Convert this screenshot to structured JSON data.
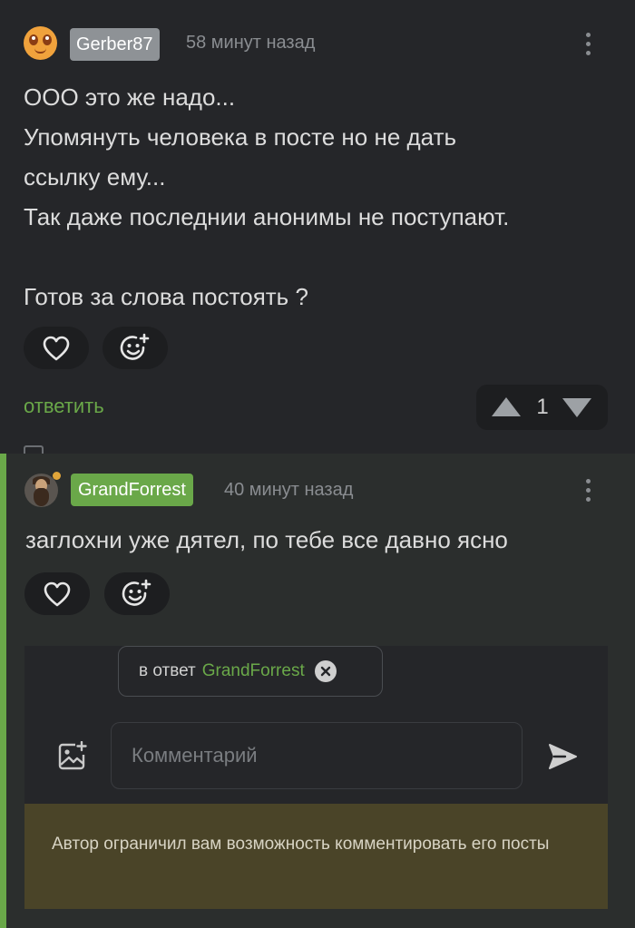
{
  "comments": [
    {
      "author": "Gerber87",
      "time": "58 минут назад",
      "body_lines": [
        "ООО это же надо...",
        "Упомянуть человека в посте но не дать",
        "ссылку ему...",
        "Так даже последнии анонимы не поступают.",
        "",
        "Готов за слова постоять ?"
      ],
      "reply_label": "ответить",
      "rating": "1"
    },
    {
      "author": "GrandForrest",
      "time": "40 минут назад",
      "body": "заглохни уже дятел, по тебе все давно ясно"
    }
  ],
  "reply_form": {
    "reply_to_prefix": "в ответ",
    "reply_to_user": "GrandForrest",
    "placeholder": "Комментарий",
    "restriction_notice": "Автор ограничил вам возможность комментировать его посты"
  },
  "colors": {
    "background": "#252629",
    "nested_background": "#2b2e2d",
    "accent_green": "#6aa849",
    "author_badge_gray": "#8e9296",
    "notice_background": "#4a4428"
  },
  "icons": [
    "heart-icon",
    "add-reaction-icon",
    "vote-up-icon",
    "vote-down-icon",
    "more-icon",
    "add-image-icon",
    "send-icon",
    "clear-icon"
  ]
}
